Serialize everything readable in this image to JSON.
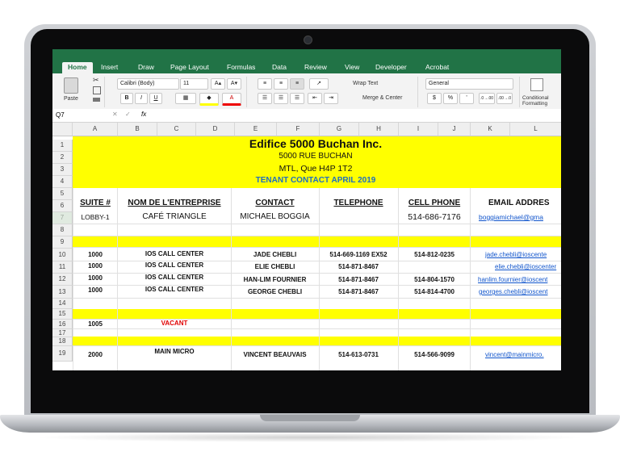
{
  "ribbon": {
    "tabs": [
      "Home",
      "Insert",
      "Draw",
      "Page Layout",
      "Formulas",
      "Data",
      "Review",
      "View",
      "Developer",
      "Acrobat"
    ],
    "paste_label": "Paste",
    "font_name": "Calibri (Body)",
    "font_size": "11",
    "wrap_text": "Wrap Text",
    "merge_center": "Merge & Center",
    "number_format": "General",
    "conditional_formatting": "Conditional Formatting",
    "increase_font": "A▴",
    "decrease_font": "A▾",
    "bold": "B",
    "italic": "I",
    "underline": "U",
    "currency": "$",
    "percent": "%",
    "comma": "’",
    "inc_decimal": ".0→.00",
    "dec_decimal": ".00→.0"
  },
  "formula_bar": {
    "name_box": "Q7",
    "fx": "fx",
    "cancel": "✕",
    "enter": "✓"
  },
  "columns": [
    "A",
    "B",
    "C",
    "D",
    "E",
    "F",
    "G",
    "H",
    "I",
    "J",
    "K",
    "L"
  ],
  "rows": [
    "1",
    "2",
    "3",
    "4",
    "5",
    "6",
    "7",
    "8",
    "9",
    "10",
    "11",
    "12",
    "13",
    "14",
    "15",
    "16",
    "17",
    "18",
    "19"
  ],
  "sheet": {
    "title": "Edifice 5000 Buchan Inc.",
    "address1": "5000 RUE BUCHAN",
    "address2": "MTL, Que H4P 1T2",
    "subtitle": "TENANT CONTACT APRIL 2019",
    "headers": {
      "suite": "SUITE #",
      "company": "NOM DE L'ENTREPRISE",
      "contact": "CONTACT",
      "telephone": "TELEPHONE",
      "cell": "CELL PHONE",
      "email": "EMAIL ADDRES"
    },
    "r7": {
      "suite": "LOBBY-1",
      "company": "CAFÉ TRIANGLE",
      "contact": "MICHAEL BOGGIA",
      "cell": "514-686-7176",
      "email": "boggiamichael@gma"
    },
    "r10": {
      "suite": "1000",
      "company": "IOS CALL CENTER",
      "contact": "JADE CHEBLI",
      "tel": "514-669-1169 EX52",
      "cell": "514-812-0235",
      "email": "jade.chebli@ioscente"
    },
    "r11": {
      "suite": "1000",
      "company": "IOS CALL CENTER",
      "contact": "ELIE CHEBLI",
      "tel": "514-871-8467",
      "email": "elie.chebli@ioscenter"
    },
    "r12": {
      "suite": "1000",
      "company": "IOS CALL CENTER",
      "contact": "HAN-LIM FOURNIER",
      "tel": "514-871-8467",
      "cell": "514-804-1570",
      "email": "hanlim.fournier@ioscent"
    },
    "r13": {
      "suite": "1000",
      "company": "IOS CALL CENTER",
      "contact": "GEORGE CHEBLI",
      "tel": "514-871-8467",
      "cell": "514-814-4700",
      "email": "georges.chebli@ioscent"
    },
    "r16": {
      "suite": "1005",
      "company": "VACANT"
    },
    "r19": {
      "suite": "2000",
      "company": "MAIN MICRO",
      "contact": "VINCENT BEAUVAIS",
      "tel": "514-613-0731",
      "cell": "514-566-9099",
      "email": "vincent@mainmicro."
    }
  },
  "colors": {
    "excel_green": "#217346",
    "highlight": "#ffff00",
    "subtitle_blue": "#1f6fc0",
    "vacant_red": "#e00000"
  }
}
